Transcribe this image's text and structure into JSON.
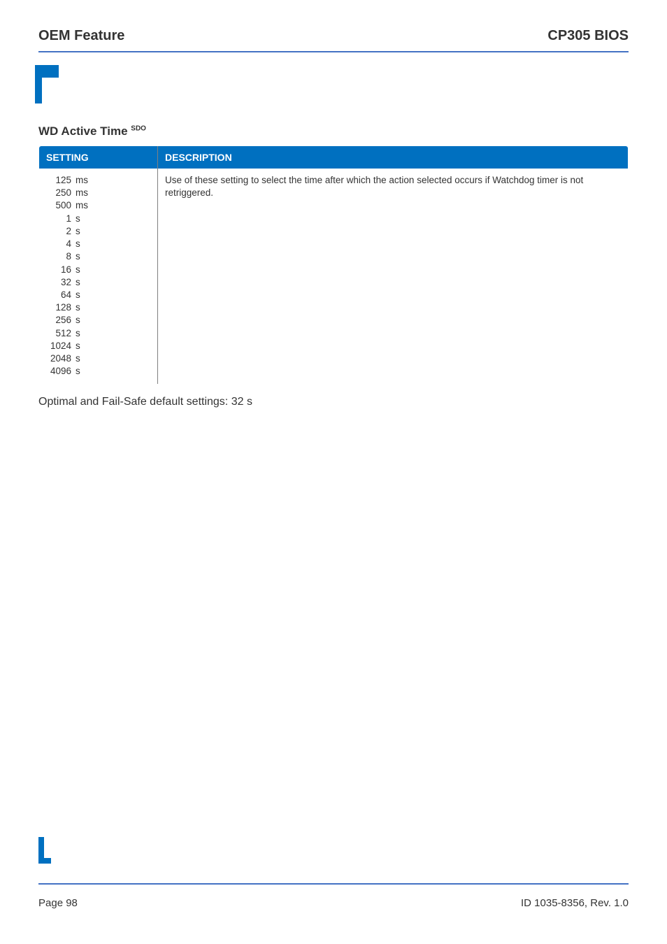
{
  "header": {
    "left": "OEM Feature",
    "right": "CP305 BIOS"
  },
  "section": {
    "title": "WD Active Time",
    "superscript": "SDO"
  },
  "table": {
    "headers": {
      "setting": "SETTING",
      "description": "DESCRIPTION"
    },
    "settings": [
      {
        "value": "125",
        "unit": "ms"
      },
      {
        "value": "250",
        "unit": "ms"
      },
      {
        "value": "500",
        "unit": "ms"
      },
      {
        "value": "1",
        "unit": "s"
      },
      {
        "value": "2",
        "unit": "s"
      },
      {
        "value": "4",
        "unit": "s"
      },
      {
        "value": "8",
        "unit": "s"
      },
      {
        "value": "16",
        "unit": "s"
      },
      {
        "value": "32",
        "unit": "s"
      },
      {
        "value": "64",
        "unit": "s"
      },
      {
        "value": "128",
        "unit": "s"
      },
      {
        "value": "256",
        "unit": "s"
      },
      {
        "value": "512",
        "unit": "s"
      },
      {
        "value": "1024",
        "unit": "s"
      },
      {
        "value": "2048",
        "unit": "s"
      },
      {
        "value": "4096",
        "unit": "s"
      }
    ],
    "description": "Use of these setting to select the time after which the action selected occurs if Watchdog timer is not retriggered."
  },
  "defaults_text": "Optimal and Fail-Safe default settings: 32 s",
  "footer": {
    "page_label": "Page 98",
    "doc_id": "ID 1035-8356, Rev. 1.0"
  },
  "colors": {
    "accent": "#4472c4",
    "table_header_bg": "#0070c0",
    "logo_fill": "#0070c0"
  }
}
